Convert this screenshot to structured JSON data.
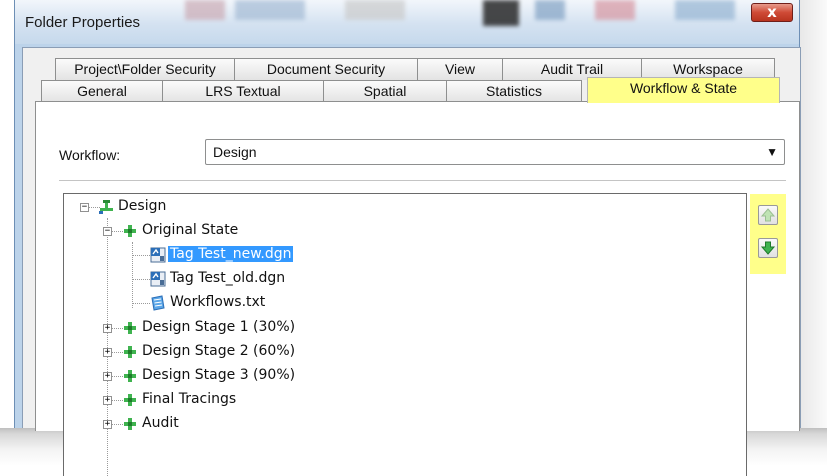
{
  "window": {
    "title": "Folder Properties",
    "close_label": "x"
  },
  "tabs": {
    "row1": [
      "Project\\Folder Security",
      "Document Security",
      "View",
      "Audit Trail",
      "Workspace"
    ],
    "row2": [
      "General",
      "LRS Textual",
      "Spatial",
      "Statistics",
      "Workflow & State"
    ],
    "active": "Workflow & State"
  },
  "workflow": {
    "label": "Workflow:",
    "value": "Design"
  },
  "tree": {
    "root": "Design",
    "original_state": "Original State",
    "files": [
      "Tag Test_new.dgn",
      "Tag Test_old.dgn",
      "Workflows.txt"
    ],
    "selected_file": "Tag Test_new.dgn",
    "stages": [
      "Design Stage 1 (30%)",
      "Design Stage 2 (60%)",
      "Design Stage 3 (90%)",
      "Final Tracings"
    ],
    "partial_item": "Audit"
  },
  "colors": {
    "highlight": "#ffff8a",
    "selection": "#3399ff",
    "state_icon": "#3fb34f"
  },
  "icons": {
    "expand": "plus-box-icon",
    "collapse": "minus-box-icon",
    "workflow": "workflow-icon",
    "state": "state-icon",
    "dgn_file": "dgn-file-icon",
    "text_file": "text-file-icon",
    "move_up": "arrow-up-icon",
    "move_down": "arrow-down-icon"
  }
}
